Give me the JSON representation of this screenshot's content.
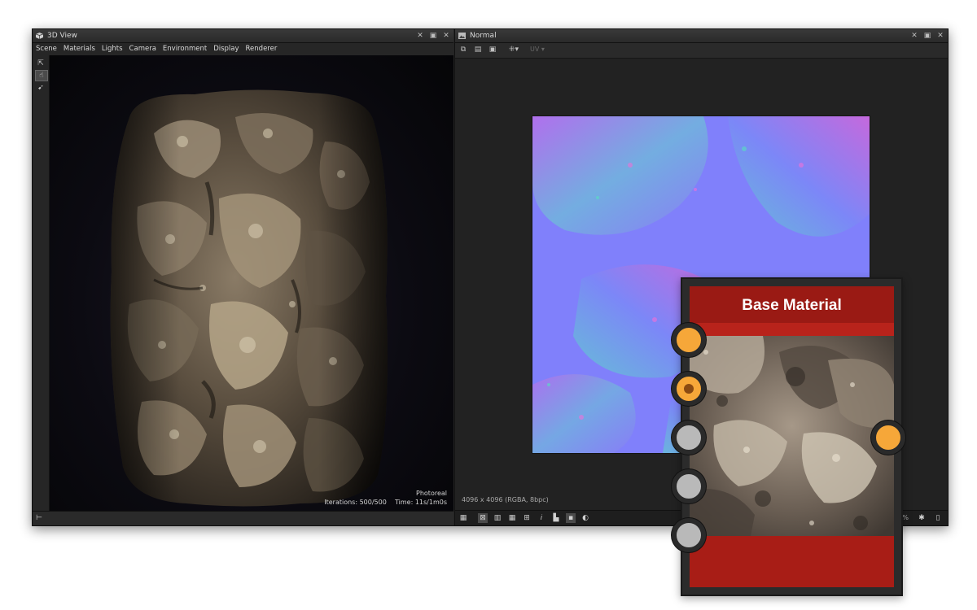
{
  "left_panel": {
    "title": "3D View",
    "menu": [
      "Scene",
      "Materials",
      "Lights",
      "Camera",
      "Environment",
      "Display",
      "Renderer"
    ],
    "render_mode": "Photoreal",
    "iterations_label": "Iterations: 500/500",
    "time_label": "Time: 11s/1m0s"
  },
  "right_panel": {
    "title": "Normal",
    "uv_label": "UV",
    "image_info": "4096 x 4096 (RGBA, 8bpc)",
    "zoom_label": "%"
  },
  "node": {
    "title": "Base Material",
    "input_ports": [
      "orange",
      "orange-selected",
      "grey",
      "grey",
      "grey"
    ],
    "output_ports": [
      "orange"
    ]
  },
  "colors": {
    "node_header": "#9a1a14",
    "node_footer": "#a81d16",
    "port_orange": "#f6a739",
    "port_grey": "#b9b9b9",
    "normal_map_base": "#7f7ffd"
  },
  "icons": {
    "titlebar_left": "cube-icon",
    "titlebar_right": "image-icon",
    "window_buttons": [
      "pin-icon",
      "restore-icon",
      "close-icon"
    ]
  }
}
